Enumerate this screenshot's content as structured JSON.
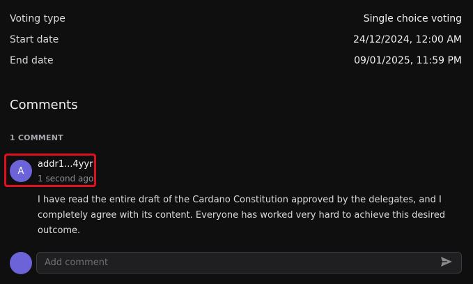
{
  "details": [
    {
      "label": "Voting type",
      "value": "Single choice voting"
    },
    {
      "label": "Start date",
      "value": "24/12/2024, 12:00 AM"
    },
    {
      "label": "End date",
      "value": "09/01/2025, 11:59 PM"
    }
  ],
  "comments": {
    "title": "Comments",
    "count_label": "1 COMMENT",
    "items": [
      {
        "avatar_letter": "A",
        "author": "addr1...4yyr",
        "time": "1 second ago",
        "text": "I have read the entire draft of the Cardano Constitution approved by the delegates, and I completely agree with its content. Everyone has worked very hard to achieve this desired outcome."
      }
    ],
    "input_placeholder": "Add comment",
    "send_icon": "send-icon"
  },
  "colors": {
    "background": "#0f0f10",
    "avatar": "#6c63d8",
    "highlight_border": "#e0101c",
    "input_bg": "#1f1f21"
  }
}
